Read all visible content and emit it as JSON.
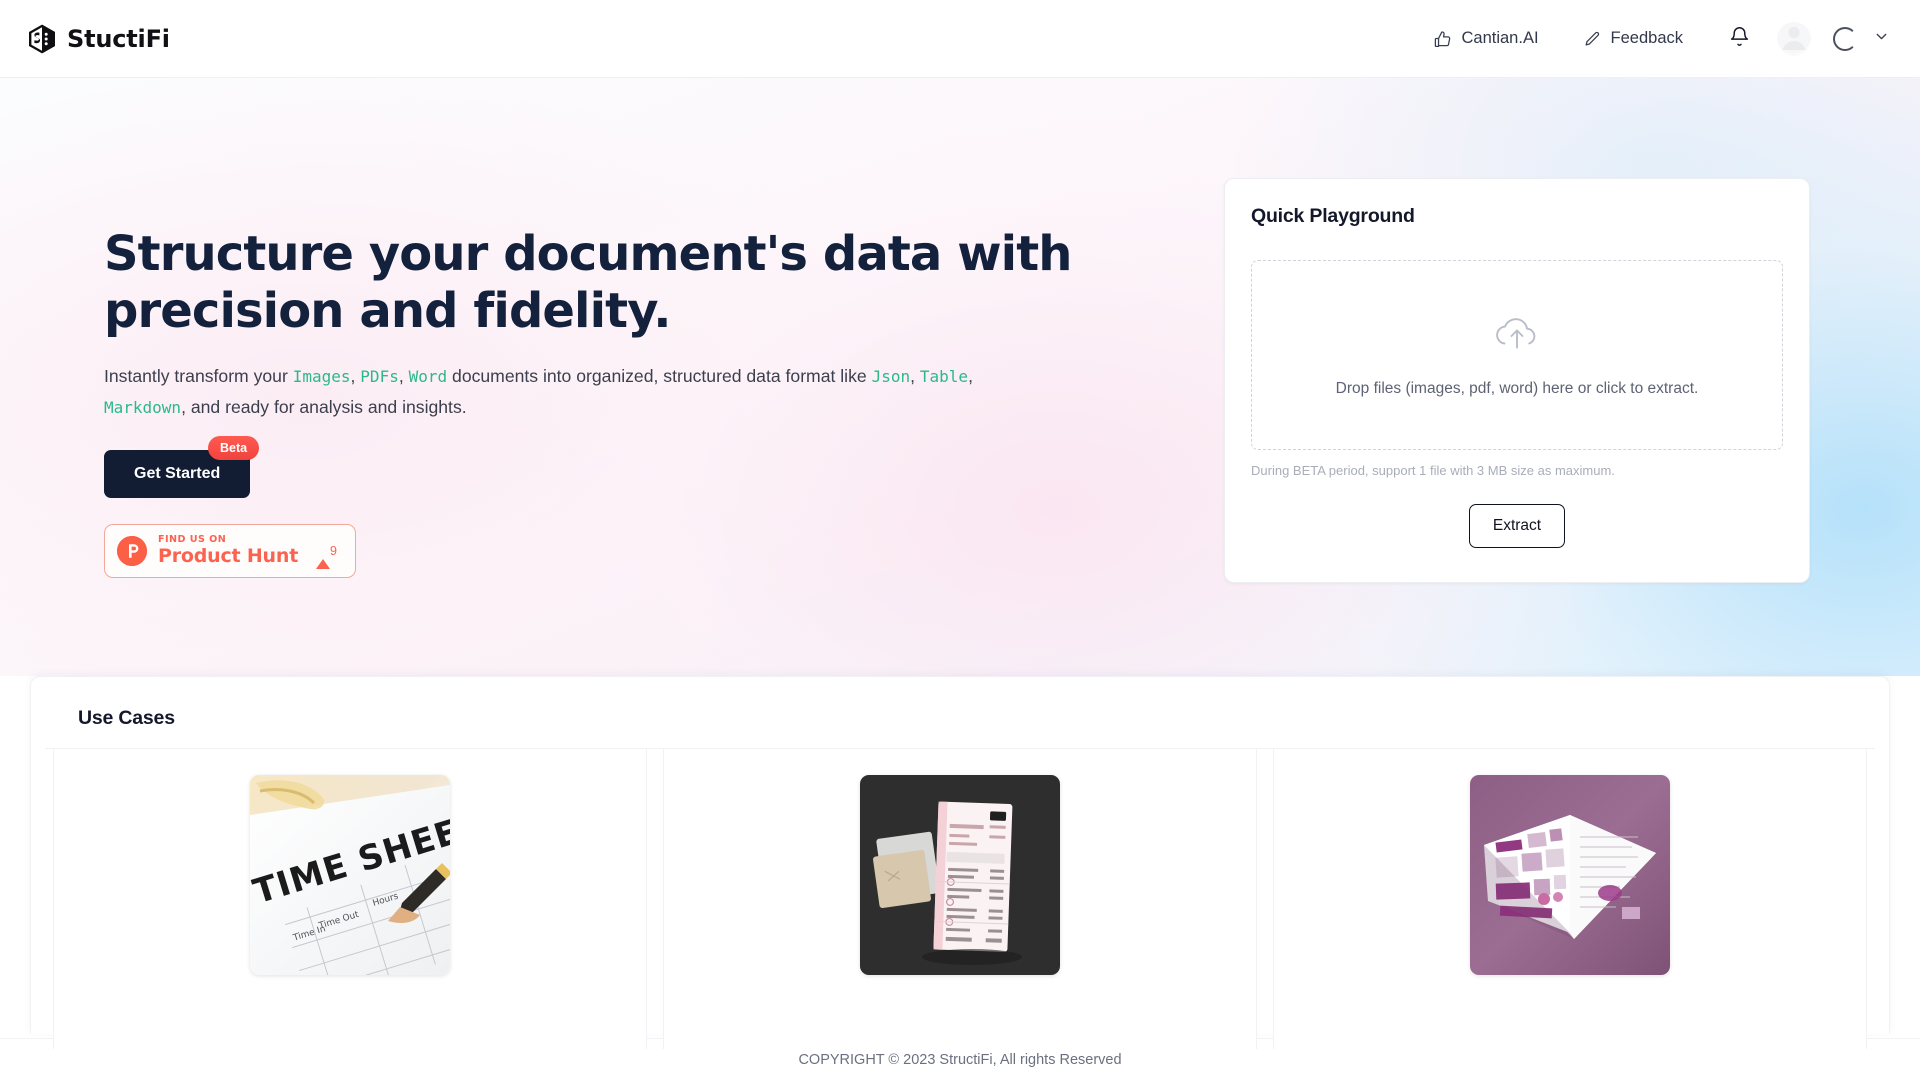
{
  "header": {
    "brand": "StuctiFi",
    "links": [
      {
        "label": "Cantian.AI",
        "icon": "thumbs-up-icon"
      },
      {
        "label": "Feedback",
        "icon": "pencil-icon"
      }
    ],
    "notification_icon": "bell-icon",
    "avatar_icon": "avatar",
    "loading_icon": "spinner-icon",
    "chevron_icon": "chevron-down-icon"
  },
  "hero": {
    "headline": "Structure your document's data with precision and fidelity.",
    "subline": {
      "p1": "Instantly transform your ",
      "kw1": "Images",
      "sep1": ", ",
      "kw2": "PDFs",
      "sep2": ", ",
      "kw3": "Word",
      "p2": " documents into organized, structured data format like ",
      "kw4": "Json",
      "sep3": ", ",
      "kw5": "Table",
      "sep4": ", ",
      "kw6": "Markdown",
      "p3": ", and ready for analysis and insights."
    },
    "cta": {
      "label": "Get Started",
      "badge": "Beta"
    },
    "product_hunt": {
      "find_us_on": "FIND US ON",
      "name": "Product Hunt",
      "upvotes": "9",
      "logo_letter": "P"
    }
  },
  "playground": {
    "title": "Quick Playground",
    "dropzone": {
      "icon": "cloud-upload-icon",
      "text": "Drop files (images, pdf, word) here or click to extract."
    },
    "note": "During BETA period, support 1 file with 3 MB size as maximum.",
    "extract_button": "Extract"
  },
  "use_cases": {
    "title": "Use Cases",
    "cards": [
      {
        "thumb": "timesheet-photo",
        "alt": "TIME SHEET document with glasses and pen"
      },
      {
        "thumb": "invoice-photo",
        "alt": "Receipt and invoice on dark background"
      },
      {
        "thumb": "catalog-photo",
        "alt": "Open magazine catalog on purple background"
      }
    ]
  },
  "footer": {
    "copyright": "COPYRIGHT © 2023 StructiFi, All rights Reserved"
  },
  "colors": {
    "headline": "#14213d",
    "accent_keyword": "#2bb98a",
    "cta_bg": "#121c33",
    "badge_red": "#f0433d",
    "product_hunt": "#fb6350"
  }
}
